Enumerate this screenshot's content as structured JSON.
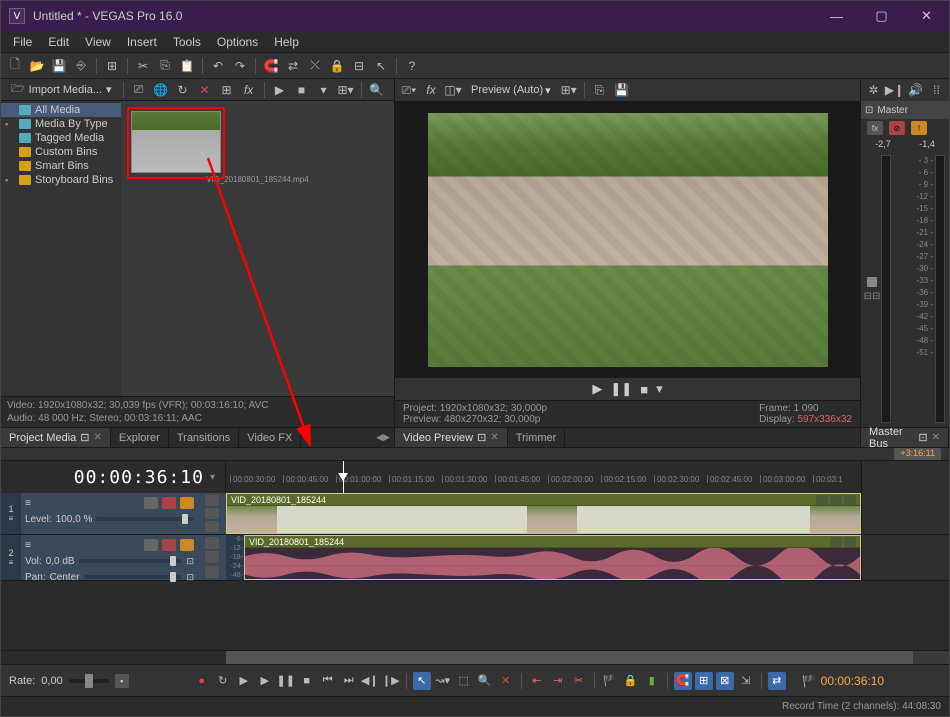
{
  "titlebar": {
    "title": "Untitled * - VEGAS Pro 16.0",
    "app_icon": "V"
  },
  "window_controls": {
    "min": "—",
    "max": "▢",
    "close": "✕"
  },
  "menubar": [
    "File",
    "Edit",
    "View",
    "Insert",
    "Tools",
    "Options",
    "Help"
  ],
  "media_panel": {
    "import_label": "Import Media...",
    "tree": {
      "all_media": "All Media",
      "by_type": "Media By Type",
      "tagged": "Tagged Media",
      "custom_bins": "Custom Bins",
      "smart_bins": "Smart Bins",
      "storyboard": "Storyboard Bins"
    },
    "thumb_label": "VID_20180801_185244.mp4",
    "status_video": "Video: 1920x1080x32; 30,039 fps (VFR); 00:03:16:10; AVC",
    "status_audio": "Audio: 48 000 Hz; Stereo; 00:03:16:11; AAC"
  },
  "panel_tabs": {
    "left": [
      "Project Media",
      "Explorer",
      "Transitions",
      "Video FX"
    ],
    "center": [
      "Video Preview",
      "Trimmer"
    ],
    "right": "Master Bus"
  },
  "preview": {
    "quality_label": "Preview (Auto)",
    "status": {
      "project_label": "Project:",
      "project_value": "1920x1080x32; 30,000p",
      "preview_label": "Preview:",
      "preview_value": "480x270x32; 30,000p",
      "frame_label": "Frame:",
      "frame_value": "1 090",
      "display_label": "Display:",
      "display_value": "597x336x32"
    },
    "transport": {
      "play": "▶",
      "pause": "❚❚",
      "stop": "■",
      "dropdown": "▾"
    }
  },
  "master": {
    "header": "Master",
    "readout_l": "-2,7",
    "readout_r": "-1,4",
    "scale": [
      "- 3 -",
      "- 6 -",
      "- 9 -",
      "-12 -",
      "-15 -",
      "-18 -",
      "-21 -",
      "-24 -",
      "-27 -",
      "-30 -",
      "-33 -",
      "-36 -",
      "-39 -",
      "-42 -",
      "-45 -",
      "-48 -",
      "-51 -"
    ]
  },
  "timeline": {
    "timecode": "00:00:36:10",
    "total_timecode": "+3:16:11",
    "ruler_marks": [
      "00:00:30:00",
      "00:00:45:00",
      "00:01:00:00",
      "00:01:15:00",
      "00:01:30:00",
      "00:01:45:00",
      "00:02:00:00",
      "00:02:15:00",
      "00:02:30:00",
      "00:02:45:00",
      "00:03:00:00",
      "00:03:1"
    ],
    "clip_name": "VID_20180801_185244",
    "track1": {
      "num": "1",
      "level_label": "Level:",
      "level_value": "100,0 %"
    },
    "track2": {
      "num": "2",
      "vol_label": "Vol:",
      "vol_value": "0,0 dB",
      "pan_label": "Pan:",
      "pan_value": "Center"
    },
    "audio_scale": [
      "-6-",
      "-12-",
      "-18-",
      "-24-",
      "-48-"
    ]
  },
  "bottom": {
    "rate_label": "Rate:",
    "rate_value": "0,00",
    "timecode": "00:00:36:10"
  },
  "statusbar": {
    "text": "Record Time (2 channels): 44:08:30"
  },
  "icons": {
    "pin": "⊡",
    "x": "✕",
    "fx": "fx",
    "dropdown": "▾",
    "gear": "⚙"
  }
}
